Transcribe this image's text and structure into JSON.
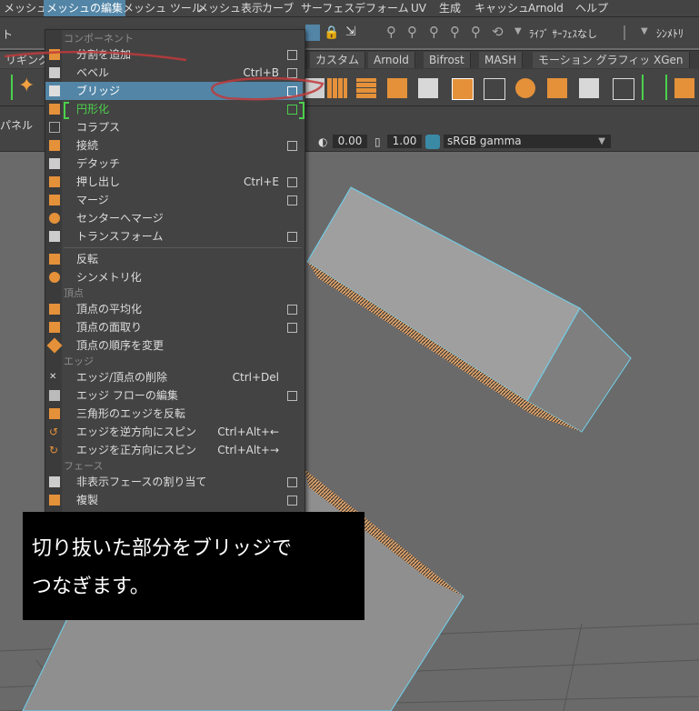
{
  "menubar": {
    "items": [
      "メッシュ",
      "メッシュの編集",
      "メッシュ ツール",
      "メッシュ表示",
      "カーブ",
      "サーフェス",
      "デフォーム",
      "UV",
      "生成",
      "キャッシュ",
      "Arnold",
      "ヘルプ"
    ]
  },
  "status": {
    "symmetry_label": "ｼﾝﾒﾄﾘ",
    "live_surface": "ﾗｲﾌﾞ ｻｰﾌｪｽなし",
    "left_fragment": "ト"
  },
  "shelf_tabs": [
    "リギング",
    "カスタム",
    "Arnold",
    "Bifrost",
    "MASH",
    "モーション グラフィックス",
    "XGen"
  ],
  "panel": {
    "label": "パネル",
    "exposure": "0.00",
    "gamma": "1.00",
    "colorspace": "sRGB gamma"
  },
  "menu": {
    "sections": {
      "component": "コンポーネント",
      "vertex": "頂点",
      "edge": "エッジ",
      "face": "フェース"
    },
    "items": [
      {
        "label": "分割を追加",
        "shortcut": "",
        "box": true
      },
      {
        "label": "ベベル",
        "shortcut": "Ctrl+B",
        "box": true
      },
      {
        "label": "ブリッジ",
        "shortcut": "",
        "box": true
      },
      {
        "label": "円形化",
        "shortcut": "",
        "box": true
      },
      {
        "label": "コラプス",
        "shortcut": "",
        "box": false
      },
      {
        "label": "接続",
        "shortcut": "",
        "box": true
      },
      {
        "label": "デタッチ",
        "shortcut": "",
        "box": false
      },
      {
        "label": "押し出し",
        "shortcut": "Ctrl+E",
        "box": true
      },
      {
        "label": "マージ",
        "shortcut": "",
        "box": true
      },
      {
        "label": "センターへマージ",
        "shortcut": "",
        "box": false
      },
      {
        "label": "トランスフォーム",
        "shortcut": "",
        "box": true
      },
      {
        "label": "反転",
        "shortcut": "",
        "box": false
      },
      {
        "label": "シンメトリ化",
        "shortcut": "",
        "box": false
      },
      {
        "label": "頂点の平均化",
        "shortcut": "",
        "box": true
      },
      {
        "label": "頂点の面取り",
        "shortcut": "",
        "box": true
      },
      {
        "label": "頂点の順序を変更",
        "shortcut": "",
        "box": false
      },
      {
        "label": "エッジ/頂点の削除",
        "shortcut": "Ctrl+Del",
        "box": false
      },
      {
        "label": "エッジ フローの編集",
        "shortcut": "",
        "box": true
      },
      {
        "label": "三角形のエッジを反転",
        "shortcut": "",
        "box": false
      },
      {
        "label": "エッジを逆方向にスピン",
        "shortcut": "Ctrl+Alt+←",
        "box": false
      },
      {
        "label": "エッジを正方向にスピン",
        "shortcut": "Ctrl+Alt+→",
        "box": false
      },
      {
        "label": "非表示フェースの割り当て",
        "shortcut": "",
        "box": true
      },
      {
        "label": "複製",
        "shortcut": "",
        "box": true
      }
    ]
  },
  "caption": {
    "line1": "切り抜いた部分をブリッジで",
    "line2": "つなぎます。"
  },
  "colors": {
    "highlight": "#5285a6",
    "green": "#4cd14c",
    "orange": "#e4913a",
    "annotation": "#c0393b"
  }
}
